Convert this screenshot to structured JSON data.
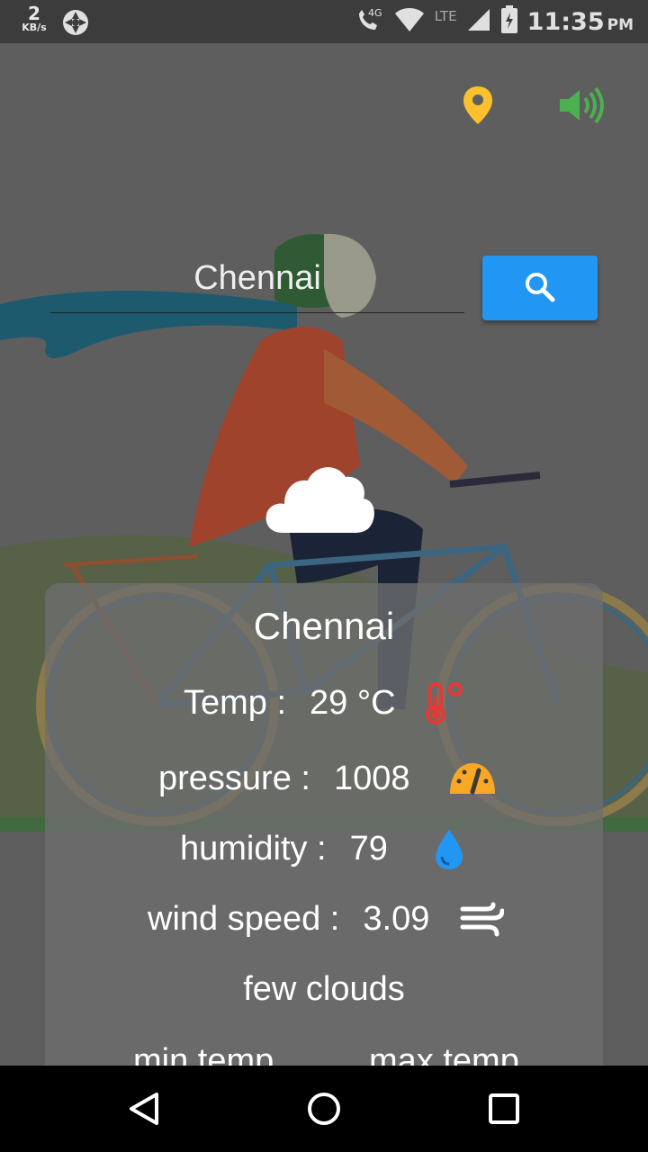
{
  "status_bar": {
    "net_speed_value": "2",
    "net_speed_unit": "KB/s",
    "network_label": "LTE",
    "network_gen": "4G",
    "time": "11:35",
    "ampm": "PM"
  },
  "search": {
    "value": "Chennai"
  },
  "weather": {
    "city": "Chennai",
    "temp_label": "Temp :",
    "temp_value": "29 °C",
    "pressure_label": "pressure :",
    "pressure_value": "1008",
    "humidity_label": "humidity :",
    "humidity_value": "79",
    "wind_label": "wind speed :",
    "wind_value": "3.09",
    "condition": "few clouds",
    "min_label": "min temp",
    "max_label": "max temp"
  },
  "colors": {
    "accent_blue": "#2196f3",
    "pin_yellow": "#fbc02d",
    "speaker_green": "#4caf50",
    "thermo_red": "#e53935",
    "gauge_orange": "#f9a825",
    "drop_blue": "#2196f3"
  },
  "icons": {
    "location": "location-pin-icon",
    "sound": "volume-icon",
    "search": "search-icon",
    "weather": "cloud-icon",
    "temp": "thermometer-icon",
    "pressure": "gauge-icon",
    "humidity": "water-drop-icon",
    "wind": "wind-icon"
  }
}
